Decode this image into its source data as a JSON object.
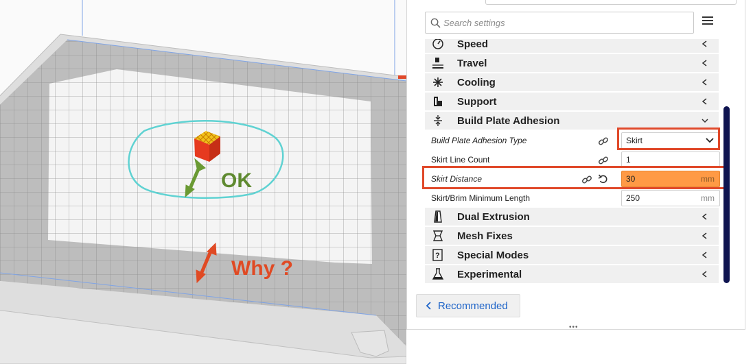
{
  "viewport": {
    "annotations": {
      "ok": "OK",
      "why": "Why ?"
    },
    "colors": {
      "ok": "#5f8a30",
      "why": "#e04a24",
      "skirt": "#5fd2d2",
      "model": "#e63a1f"
    }
  },
  "settings_panel": {
    "search": {
      "placeholder": "Search settings",
      "icon": "search-icon"
    },
    "menu_icon": "hamburger-icon",
    "categories": [
      {
        "label": "Speed",
        "icon": "speed-icon",
        "expanded": false
      },
      {
        "label": "Travel",
        "icon": "travel-icon",
        "expanded": false
      },
      {
        "label": "Cooling",
        "icon": "fan-icon",
        "expanded": false
      },
      {
        "label": "Support",
        "icon": "support-icon",
        "expanded": false
      },
      {
        "label": "Build Plate Adhesion",
        "icon": "adhesion-icon",
        "expanded": true
      },
      {
        "label": "Dual Extrusion",
        "icon": "dual-extrusion-icon",
        "expanded": false
      },
      {
        "label": "Mesh Fixes",
        "icon": "mesh-fixes-icon",
        "expanded": false
      },
      {
        "label": "Special Modes",
        "icon": "special-modes-icon",
        "expanded": false
      },
      {
        "label": "Experimental",
        "icon": "experimental-icon",
        "expanded": false
      }
    ],
    "adhesion_settings": {
      "type": {
        "label": "Build Plate Adhesion Type",
        "value": "Skirt"
      },
      "line_count": {
        "label": "Skirt Line Count",
        "value": "1"
      },
      "distance": {
        "label": "Skirt Distance",
        "value": "30",
        "unit": "mm"
      },
      "min_length": {
        "label": "Skirt/Brim Minimum Length",
        "value": "250",
        "unit": "mm"
      }
    },
    "recommended_button": "Recommended",
    "accent_color": "#1e64c8",
    "highlight_color": "#ff9a45",
    "callout_color": "#e0492a"
  }
}
